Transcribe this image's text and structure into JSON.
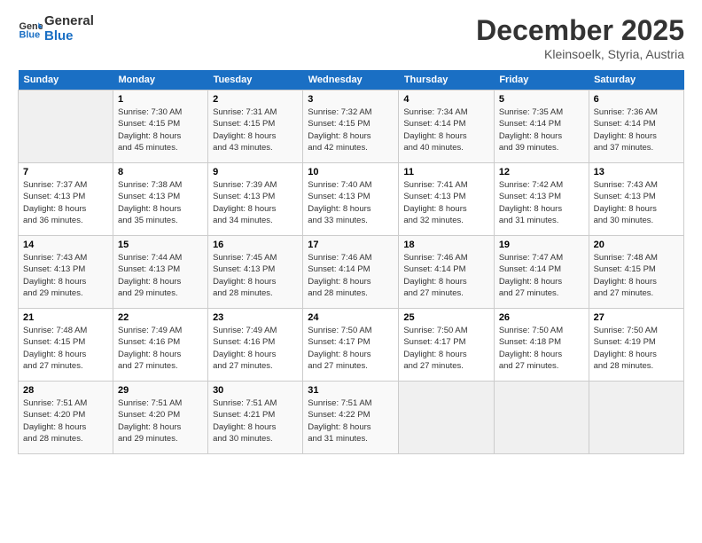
{
  "logo": {
    "line1": "General",
    "line2": "Blue"
  },
  "title": "December 2025",
  "subtitle": "Kleinsoelk, Styria, Austria",
  "days_header": [
    "Sunday",
    "Monday",
    "Tuesday",
    "Wednesday",
    "Thursday",
    "Friday",
    "Saturday"
  ],
  "weeks": [
    [
      {
        "day": "",
        "info": ""
      },
      {
        "day": "1",
        "info": "Sunrise: 7:30 AM\nSunset: 4:15 PM\nDaylight: 8 hours\nand 45 minutes."
      },
      {
        "day": "2",
        "info": "Sunrise: 7:31 AM\nSunset: 4:15 PM\nDaylight: 8 hours\nand 43 minutes."
      },
      {
        "day": "3",
        "info": "Sunrise: 7:32 AM\nSunset: 4:15 PM\nDaylight: 8 hours\nand 42 minutes."
      },
      {
        "day": "4",
        "info": "Sunrise: 7:34 AM\nSunset: 4:14 PM\nDaylight: 8 hours\nand 40 minutes."
      },
      {
        "day": "5",
        "info": "Sunrise: 7:35 AM\nSunset: 4:14 PM\nDaylight: 8 hours\nand 39 minutes."
      },
      {
        "day": "6",
        "info": "Sunrise: 7:36 AM\nSunset: 4:14 PM\nDaylight: 8 hours\nand 37 minutes."
      }
    ],
    [
      {
        "day": "7",
        "info": "Sunrise: 7:37 AM\nSunset: 4:13 PM\nDaylight: 8 hours\nand 36 minutes."
      },
      {
        "day": "8",
        "info": "Sunrise: 7:38 AM\nSunset: 4:13 PM\nDaylight: 8 hours\nand 35 minutes."
      },
      {
        "day": "9",
        "info": "Sunrise: 7:39 AM\nSunset: 4:13 PM\nDaylight: 8 hours\nand 34 minutes."
      },
      {
        "day": "10",
        "info": "Sunrise: 7:40 AM\nSunset: 4:13 PM\nDaylight: 8 hours\nand 33 minutes."
      },
      {
        "day": "11",
        "info": "Sunrise: 7:41 AM\nSunset: 4:13 PM\nDaylight: 8 hours\nand 32 minutes."
      },
      {
        "day": "12",
        "info": "Sunrise: 7:42 AM\nSunset: 4:13 PM\nDaylight: 8 hours\nand 31 minutes."
      },
      {
        "day": "13",
        "info": "Sunrise: 7:43 AM\nSunset: 4:13 PM\nDaylight: 8 hours\nand 30 minutes."
      }
    ],
    [
      {
        "day": "14",
        "info": "Sunrise: 7:43 AM\nSunset: 4:13 PM\nDaylight: 8 hours\nand 29 minutes."
      },
      {
        "day": "15",
        "info": "Sunrise: 7:44 AM\nSunset: 4:13 PM\nDaylight: 8 hours\nand 29 minutes."
      },
      {
        "day": "16",
        "info": "Sunrise: 7:45 AM\nSunset: 4:13 PM\nDaylight: 8 hours\nand 28 minutes."
      },
      {
        "day": "17",
        "info": "Sunrise: 7:46 AM\nSunset: 4:14 PM\nDaylight: 8 hours\nand 28 minutes."
      },
      {
        "day": "18",
        "info": "Sunrise: 7:46 AM\nSunset: 4:14 PM\nDaylight: 8 hours\nand 27 minutes."
      },
      {
        "day": "19",
        "info": "Sunrise: 7:47 AM\nSunset: 4:14 PM\nDaylight: 8 hours\nand 27 minutes."
      },
      {
        "day": "20",
        "info": "Sunrise: 7:48 AM\nSunset: 4:15 PM\nDaylight: 8 hours\nand 27 minutes."
      }
    ],
    [
      {
        "day": "21",
        "info": "Sunrise: 7:48 AM\nSunset: 4:15 PM\nDaylight: 8 hours\nand 27 minutes."
      },
      {
        "day": "22",
        "info": "Sunrise: 7:49 AM\nSunset: 4:16 PM\nDaylight: 8 hours\nand 27 minutes."
      },
      {
        "day": "23",
        "info": "Sunrise: 7:49 AM\nSunset: 4:16 PM\nDaylight: 8 hours\nand 27 minutes."
      },
      {
        "day": "24",
        "info": "Sunrise: 7:50 AM\nSunset: 4:17 PM\nDaylight: 8 hours\nand 27 minutes."
      },
      {
        "day": "25",
        "info": "Sunrise: 7:50 AM\nSunset: 4:17 PM\nDaylight: 8 hours\nand 27 minutes."
      },
      {
        "day": "26",
        "info": "Sunrise: 7:50 AM\nSunset: 4:18 PM\nDaylight: 8 hours\nand 27 minutes."
      },
      {
        "day": "27",
        "info": "Sunrise: 7:50 AM\nSunset: 4:19 PM\nDaylight: 8 hours\nand 28 minutes."
      }
    ],
    [
      {
        "day": "28",
        "info": "Sunrise: 7:51 AM\nSunset: 4:20 PM\nDaylight: 8 hours\nand 28 minutes."
      },
      {
        "day": "29",
        "info": "Sunrise: 7:51 AM\nSunset: 4:20 PM\nDaylight: 8 hours\nand 29 minutes."
      },
      {
        "day": "30",
        "info": "Sunrise: 7:51 AM\nSunset: 4:21 PM\nDaylight: 8 hours\nand 30 minutes."
      },
      {
        "day": "31",
        "info": "Sunrise: 7:51 AM\nSunset: 4:22 PM\nDaylight: 8 hours\nand 31 minutes."
      },
      {
        "day": "",
        "info": ""
      },
      {
        "day": "",
        "info": ""
      },
      {
        "day": "",
        "info": ""
      }
    ]
  ]
}
